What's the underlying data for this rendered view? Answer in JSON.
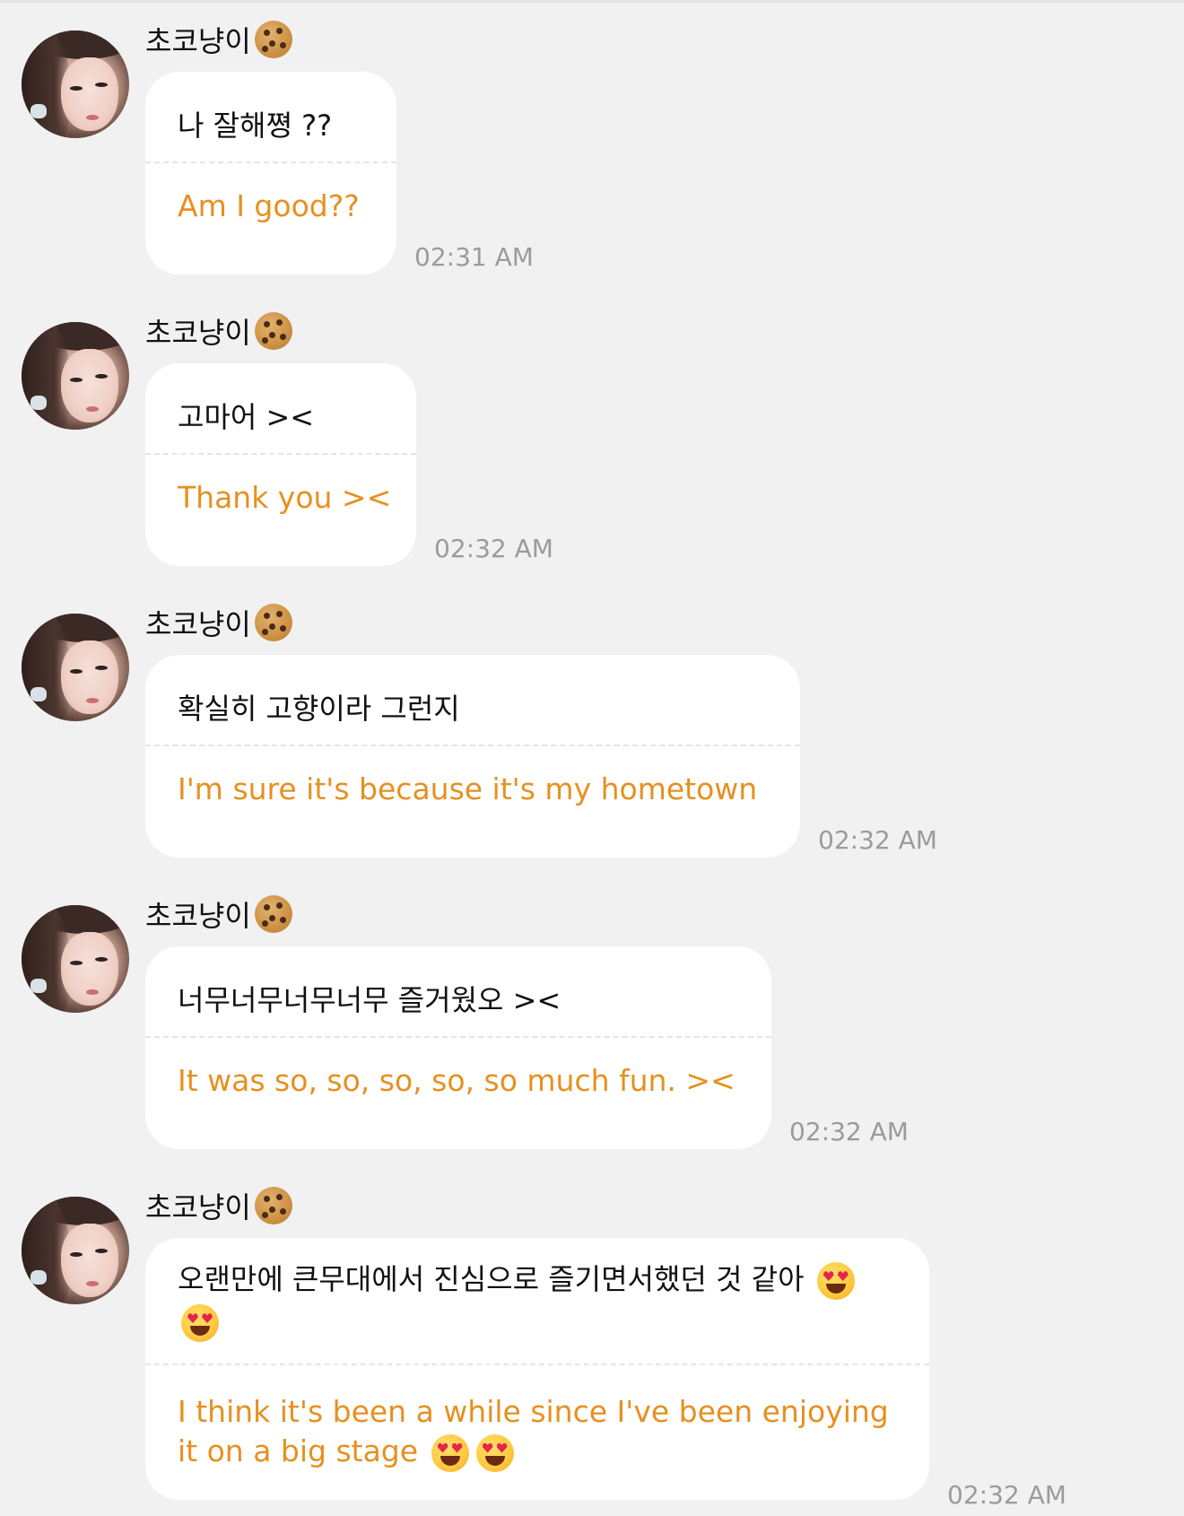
{
  "messages": [
    {
      "sender": "초코냥이",
      "sender_emoji": "cookie",
      "original": "나 잘해쪙 ??",
      "translation": "Am I good??",
      "time": "02:31 AM"
    },
    {
      "sender": "초코냥이",
      "sender_emoji": "cookie",
      "original": "고마어 ><",
      "translation": "Thank you ><",
      "time": "02:32 AM"
    },
    {
      "sender": "초코냥이",
      "sender_emoji": "cookie",
      "original": "확실히 고향이라 그런지",
      "translation": "I'm sure it's because it's my hometown",
      "time": "02:32 AM"
    },
    {
      "sender": "초코냥이",
      "sender_emoji": "cookie",
      "original": "너무너무너무너무 즐거웠오 ><",
      "translation": "It was so, so, so, so, so much fun. ><",
      "time": "02:32 AM"
    },
    {
      "sender": "초코냥이",
      "sender_emoji": "cookie",
      "original_line1": "오랜만에 큰무대에서 진심으로 즐기면서했던 것 같아",
      "original_emoji": "heart-eyes",
      "translation_line1": "I think it's been a while since I've been enjoying",
      "translation_line2": "it on a big stage",
      "translation_emoji": "heart-eyes",
      "time": "02:32 AM"
    }
  ],
  "colors": {
    "background": "#f1f1f1",
    "bubble": "#ffffff",
    "translation_text": "#e69021",
    "timestamp": "#9b9b9b"
  }
}
